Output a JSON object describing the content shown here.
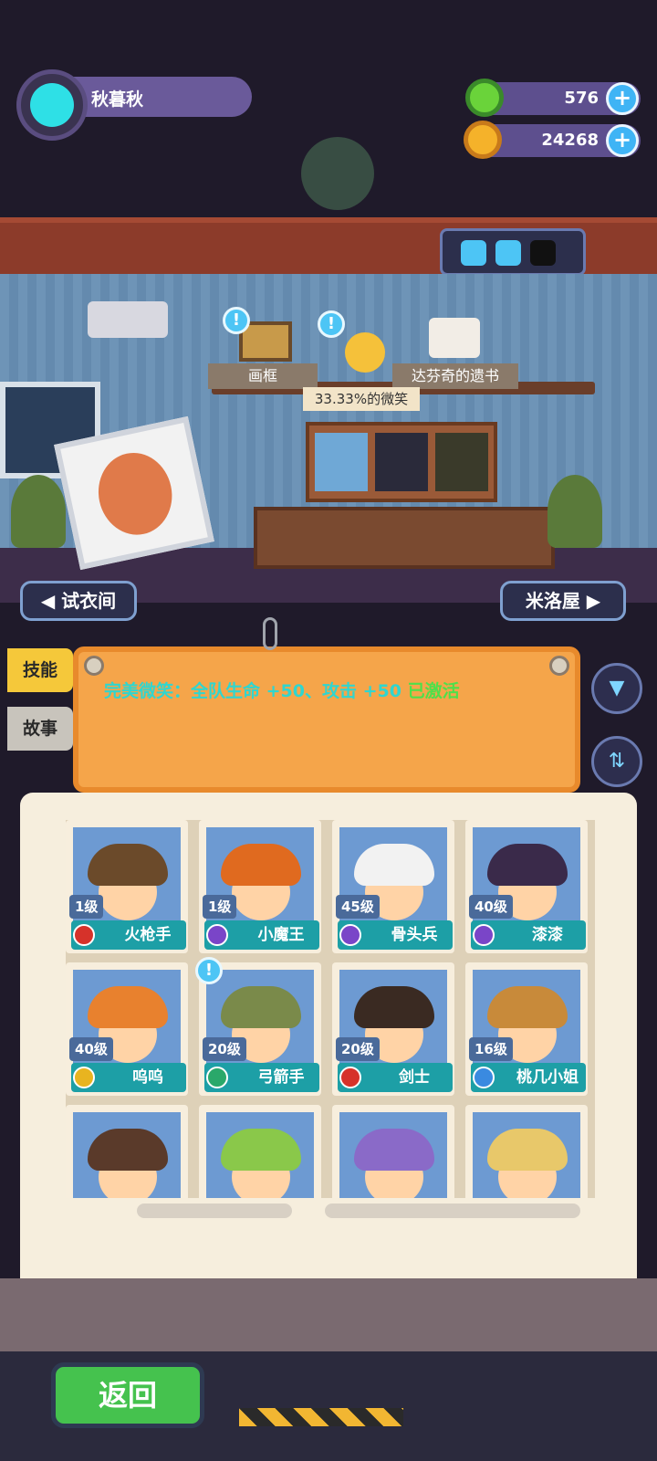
{
  "player": {
    "name": "秋暮秋"
  },
  "currency": {
    "gems": "576",
    "coins": "24268"
  },
  "room": {
    "shelf_labels": [
      "画框",
      "达芬奇的遗书"
    ],
    "smile_label": "33.33%的微笑",
    "left_nav": "试衣间",
    "right_nav": "米洛屋"
  },
  "tabs": {
    "skill": "技能",
    "story": "故事"
  },
  "notice": {
    "text": "完美微笑：全队生命 +50、攻击 +50 ",
    "status": "已激活"
  },
  "characters": [
    {
      "level": "1级",
      "name": "火枪手",
      "elem_color": "#d6322a",
      "hair": "#6b4a2a"
    },
    {
      "level": "1级",
      "name": "小魔王",
      "elem_color": "#7a45c8",
      "hair": "#e06a1f"
    },
    {
      "level": "45级",
      "name": "骨头兵",
      "elem_color": "#7a45c8",
      "hair": "#f2f2f2"
    },
    {
      "level": "40级",
      "name": "漆漆",
      "elem_color": "#7a45c8",
      "hair": "#3a2a4a"
    },
    {
      "level": "40级",
      "name": "呜呜",
      "elem_color": "#e8b420",
      "hair": "#e8812e"
    },
    {
      "level": "20级",
      "name": "弓箭手",
      "elem_color": "#2aa86a",
      "hair": "#7a8a4a"
    },
    {
      "level": "20级",
      "name": "剑士",
      "elem_color": "#d6322a",
      "hair": "#3a2a22"
    },
    {
      "level": "16级",
      "name": "桃几小姐",
      "elem_color": "#3a8ae0",
      "hair": "#c88a3a"
    },
    {
      "level": "",
      "name": "",
      "elem_color": "#000",
      "hair": "#5a3a2a"
    },
    {
      "level": "",
      "name": "",
      "elem_color": "#000",
      "hair": "#8ac84a"
    },
    {
      "level": "",
      "name": "",
      "elem_color": "#000",
      "hair": "#8a6ac8"
    },
    {
      "level": "",
      "name": "",
      "elem_color": "#000",
      "hair": "#e8c86a"
    }
  ],
  "footer": {
    "back_label": "返回"
  },
  "colors": {
    "accent_teal": "#1d9fa6",
    "active_green": "#4ee04a",
    "board_orange": "#f5a54a"
  }
}
